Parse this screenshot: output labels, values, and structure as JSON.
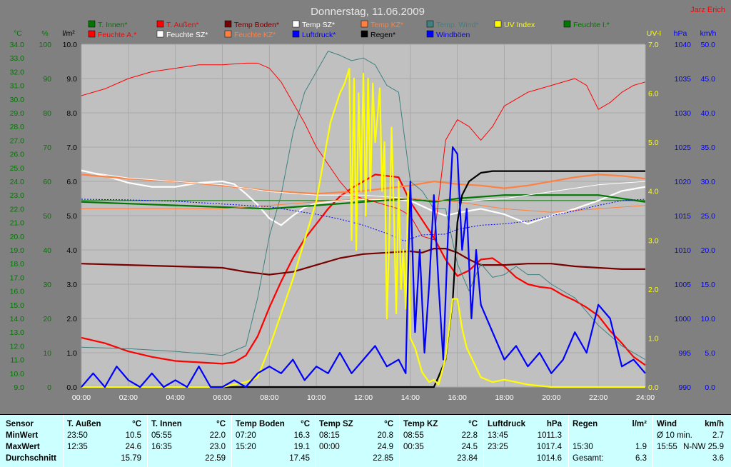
{
  "title": "Donnerstag, 11.06.2009",
  "author": "Jarz Erich",
  "colors": {
    "background": "#808080",
    "plot_background": "#c0c0c0",
    "stats_background": "#ccffff"
  },
  "legend": [
    {
      "label": "T. Innen*",
      "color": "#007700"
    },
    {
      "label": "T. Außen*",
      "color": "#ff0000"
    },
    {
      "label": "Temp Boden*",
      "color": "#770000"
    },
    {
      "label": "Temp SZ*",
      "color": "#ffffff"
    },
    {
      "label": "Temp KZ*",
      "color": "#ff8040"
    },
    {
      "label": "Temp. Wind*",
      "color": "#408080"
    },
    {
      "label": "UV Index",
      "color": "#ffff00"
    },
    {
      "label": "Feuchte I.*",
      "color": "#007700"
    },
    {
      "label": "Feuchte A.*",
      "color": "#ff0000"
    },
    {
      "label": "Feuchte SZ*",
      "color": "#ffffff"
    },
    {
      "label": "Feuchte KZ*",
      "color": "#ff8040"
    },
    {
      "label": "Luftdruck*",
      "color": "#0000ff"
    },
    {
      "label": "Regen*",
      "color": "#000000"
    },
    {
      "label": "Windböen",
      "color": "#0000ff"
    }
  ],
  "axes": {
    "temp": {
      "unit": "°C",
      "color": "#007700",
      "ticks": [
        "9.0",
        "10.0",
        "11.0",
        "12.0",
        "13.0",
        "14.0",
        "15.0",
        "16.0",
        "17.0",
        "18.0",
        "19.0",
        "20.0",
        "21.0",
        "22.0",
        "23.0",
        "24.0",
        "25.0",
        "26.0",
        "27.0",
        "28.0",
        "29.0",
        "30.0",
        "31.0",
        "32.0",
        "33.0",
        "34.0"
      ]
    },
    "humidity": {
      "unit": "%",
      "color": "#007700",
      "ticks": [
        "0",
        "10",
        "20",
        "30",
        "40",
        "50",
        "60",
        "70",
        "80",
        "90",
        "100"
      ]
    },
    "rain": {
      "unit": "l/m²",
      "color": "#000000",
      "ticks": [
        "0.0",
        "1.0",
        "2.0",
        "3.0",
        "4.0",
        "5.0",
        "6.0",
        "7.0",
        "8.0",
        "9.0",
        "10.0"
      ]
    },
    "uv": {
      "unit": "UV-I",
      "color": "#ffff00",
      "ticks": [
        "0.0",
        "1.0",
        "2.0",
        "3.0",
        "4.0",
        "5.0",
        "6.0",
        "7.0"
      ]
    },
    "pressure": {
      "unit": "hPa",
      "color": "#0000ff",
      "ticks": [
        "990",
        "995",
        "1000",
        "1005",
        "1010",
        "1015",
        "1020",
        "1025",
        "1030",
        "1035",
        "1040"
      ]
    },
    "wind": {
      "unit": "km/h",
      "color": "#0000ff",
      "ticks": [
        "0.0",
        "5.0",
        "10.0",
        "15.0",
        "20.0",
        "25.0",
        "30.0",
        "35.0",
        "40.0",
        "45.0",
        "50.0"
      ]
    },
    "time": {
      "ticks": [
        "00:00",
        "02:00",
        "04:00",
        "06:00",
        "08:00",
        "10:00",
        "12:00",
        "14:00",
        "16:00",
        "18:00",
        "20:00",
        "22:00",
        "24:00"
      ]
    }
  },
  "chart_data": {
    "type": "line",
    "title": "Donnerstag, 11.06.2009",
    "x_unit": "hour of day",
    "xlim": [
      0,
      24
    ],
    "grid": true,
    "series": [
      {
        "name": "T. Innen*",
        "axis": "temp",
        "color": "#007700",
        "x": [
          0,
          24
        ],
        "y": [
          22.6,
          22.6
        ]
      },
      {
        "name": "T. Außen*",
        "axis": "temp",
        "color": "#ff0000",
        "x": [
          0,
          1,
          2,
          3,
          4,
          5,
          6,
          6.5,
          7,
          7.5,
          8,
          8.5,
          9,
          9.5,
          10,
          10.5,
          11,
          11.5,
          12,
          12.5,
          13,
          13.5,
          14,
          14.5,
          15,
          15.5,
          16,
          16.5,
          17,
          17.5,
          18,
          18.5,
          19,
          19.5,
          20,
          20.5,
          21,
          21.5,
          22,
          22.5,
          23,
          23.5,
          24
        ],
        "y": [
          12.6,
          12.2,
          11.6,
          11.2,
          10.9,
          10.8,
          10.7,
          10.8,
          11.3,
          12.7,
          14.8,
          16.7,
          18.4,
          19.8,
          20.9,
          22.0,
          22.9,
          23.5,
          24.0,
          24.5,
          24.4,
          24.3,
          22.5,
          21.2,
          19.9,
          18.3,
          17.1,
          17.5,
          18.3,
          18.4,
          17.8,
          17.0,
          16.5,
          16.3,
          16.2,
          15.7,
          15.3,
          14.8,
          14.2,
          13.1,
          12.2,
          11.2,
          10.6
        ]
      },
      {
        "name": "Temp Boden*",
        "axis": "temp",
        "color": "#770000",
        "x": [
          0,
          2,
          4,
          6,
          7,
          8,
          9,
          10,
          11,
          12,
          13,
          14,
          14.5,
          15,
          15.5,
          16,
          16.5,
          17,
          18,
          19,
          20,
          21,
          22,
          23,
          24
        ],
        "y": [
          18.0,
          17.9,
          17.8,
          17.7,
          17.4,
          17.2,
          17.4,
          17.9,
          18.4,
          18.7,
          18.8,
          18.9,
          18.8,
          19.1,
          19.1,
          18.8,
          18.3,
          17.9,
          17.9,
          18.0,
          18.0,
          17.8,
          17.7,
          17.6,
          17.6
        ]
      },
      {
        "name": "Temp SZ*",
        "axis": "temp",
        "color": "#ffffff",
        "x": [
          0,
          1,
          2,
          3,
          4,
          5,
          6,
          6.5,
          7,
          7.5,
          8,
          8.5,
          9,
          9.5,
          10,
          11,
          12,
          13,
          14,
          15,
          15.5,
          16,
          17,
          18,
          19,
          20,
          21,
          22,
          23,
          24
        ],
        "y": [
          24.8,
          24.4,
          23.9,
          23.6,
          23.6,
          23.9,
          24.0,
          23.8,
          23.1,
          22.3,
          21.3,
          20.8,
          21.5,
          22.1,
          22.4,
          22.6,
          22.7,
          22.7,
          22.6,
          21.8,
          21.5,
          21.7,
          22.0,
          21.6,
          20.9,
          21.5,
          22.0,
          22.6,
          23.3,
          23.6
        ]
      },
      {
        "name": "Temp KZ*",
        "axis": "temp",
        "color": "#ff8040",
        "x": [
          0,
          2,
          4,
          6,
          8,
          10,
          12,
          14,
          15,
          16,
          17,
          18,
          19,
          20,
          21,
          22,
          23,
          24
        ],
        "y": [
          24.5,
          24.2,
          24.0,
          23.7,
          23.3,
          23.1,
          23.3,
          23.7,
          24.0,
          23.8,
          23.7,
          23.5,
          23.7,
          24.0,
          24.3,
          24.5,
          24.4,
          24.2
        ]
      },
      {
        "name": "Temp. Wind*",
        "axis": "temp",
        "color": "#408080",
        "x": [
          0,
          2,
          4,
          6,
          7,
          7.5,
          8,
          8.5,
          9,
          9.5,
          10,
          10.5,
          11,
          11.5,
          12,
          12.5,
          13,
          13.5,
          14,
          14.5,
          15,
          15.5,
          16,
          16.5,
          17,
          17.5,
          18,
          18.5,
          19,
          19.5,
          20,
          21,
          22,
          23,
          24
        ],
        "y": [
          11.9,
          11.8,
          11.6,
          11.3,
          12.0,
          15.5,
          20.0,
          23.0,
          27.5,
          30.5,
          32.0,
          33.5,
          33.2,
          32.8,
          33.0,
          32.5,
          31.0,
          30.5,
          24.0,
          23.3,
          22.0,
          22.0,
          18.0,
          16.0,
          18.0,
          17.0,
          17.2,
          17.8,
          17.2,
          17.2,
          16.5,
          15.5,
          13.5,
          12.0,
          11.0
        ]
      },
      {
        "name": "Feuchte I.*",
        "axis": "humidity",
        "color": "#007700",
        "x": [
          0,
          2,
          4,
          6,
          8,
          10,
          12,
          14,
          15,
          16,
          18,
          20,
          22,
          24
        ],
        "y": [
          54,
          53.5,
          53,
          52.5,
          52,
          53,
          54,
          55,
          54,
          55,
          56,
          56,
          56,
          54
        ]
      },
      {
        "name": "Feuchte A.*",
        "axis": "humidity",
        "color": "#ff0000",
        "x": [
          0,
          1,
          2,
          3,
          4,
          5,
          6,
          7,
          7.5,
          8,
          8.5,
          9,
          9.5,
          10,
          10.5,
          11,
          11.5,
          12,
          12.5,
          13,
          13.5,
          14,
          14.5,
          15,
          15.5,
          16,
          16.5,
          17,
          17.5,
          18,
          19,
          20,
          21,
          21.5,
          22,
          22.5,
          23,
          23.5,
          24
        ],
        "y": [
          85,
          87,
          90,
          92,
          93,
          94,
          94,
          94.5,
          94.5,
          93,
          89,
          83,
          77,
          70,
          65,
          60,
          56,
          55,
          54,
          53,
          52,
          50,
          44,
          43,
          72,
          78,
          76,
          72,
          76,
          82,
          86,
          88,
          90,
          88,
          81,
          83,
          86,
          88,
          89
        ]
      },
      {
        "name": "Feuchte SZ*",
        "axis": "humidity",
        "color": "#ffffff",
        "x": [
          0,
          2,
          4,
          6,
          8,
          10,
          12,
          14,
          16,
          18,
          20,
          22,
          24
        ],
        "y": [
          63,
          61,
          60,
          59,
          57,
          56,
          56,
          55,
          54,
          55,
          57,
          59,
          60
        ]
      },
      {
        "name": "Feuchte KZ*",
        "axis": "humidity",
        "color": "#ff8040",
        "x": [
          0,
          2,
          4,
          6,
          8,
          10,
          12,
          14,
          16,
          18,
          20,
          22,
          24
        ],
        "y": [
          52,
          52,
          52,
          52,
          53,
          54,
          55,
          55,
          54,
          52,
          51,
          52,
          53
        ]
      },
      {
        "name": "Luftdruck*",
        "axis": "pressure",
        "color": "#0000ff",
        "x": [
          0,
          2,
          4,
          6,
          8,
          10,
          11,
          12,
          13,
          13.75,
          14.5,
          15.5,
          16,
          17,
          18,
          19,
          20,
          21,
          22,
          23,
          24
        ],
        "y": [
          1017.4,
          1017.3,
          1017.1,
          1016.7,
          1016.3,
          1015.2,
          1014.5,
          1013.6,
          1012.4,
          1011.3,
          1012.2,
          1012.3,
          1013.0,
          1013.6,
          1013.8,
          1014.2,
          1015.0,
          1015.7,
          1016.5,
          1017.2,
          1017.4
        ]
      },
      {
        "name": "Regen*",
        "axis": "rain",
        "color": "#000000",
        "x": [
          0,
          15.0,
          15.2,
          15.5,
          15.8,
          16.0,
          16.2,
          16.5,
          17.0,
          17.5,
          18,
          24
        ],
        "y": [
          0,
          0,
          0.3,
          0.8,
          2.5,
          4.8,
          5.6,
          6.0,
          6.25,
          6.3,
          6.3,
          6.3
        ]
      },
      {
        "name": "UV Index",
        "axis": "uv",
        "color": "#ffff00",
        "x": [
          0,
          6,
          6.5,
          7,
          7.5,
          8,
          8.5,
          9,
          9.5,
          10,
          10.3,
          10.6,
          11,
          11.2,
          11.4,
          11.5,
          11.6,
          11.7,
          11.8,
          11.9,
          12,
          12.1,
          12.2,
          12.3,
          12.4,
          12.5,
          12.6,
          12.7,
          12.8,
          12.9,
          13,
          13.1,
          13.2,
          13.3,
          13.4,
          13.5,
          13.6,
          13.7,
          13.8,
          13.9,
          14,
          14.2,
          14.5,
          14.8,
          15,
          15.2,
          15.5,
          15.8,
          16,
          16.2,
          16.4,
          16.6,
          16.8,
          17,
          17.5,
          18,
          19,
          20,
          21,
          22,
          23,
          24
        ],
        "y": [
          0,
          0,
          0.05,
          0.1,
          0.2,
          0.8,
          1.5,
          2.2,
          3.0,
          3.8,
          4.6,
          5.4,
          6.0,
          6.2,
          6.5,
          3.0,
          6.3,
          2.8,
          6.0,
          4.0,
          6.4,
          3.5,
          6.3,
          4.0,
          6.2,
          5.0,
          5.5,
          6.1,
          4.0,
          5.0,
          1.4,
          3.0,
          5.3,
          3.5,
          1.5,
          4.2,
          2.0,
          2.8,
          1.6,
          4.0,
          1.0,
          0.8,
          0.3,
          0.1,
          0.15,
          0.05,
          0.6,
          1.8,
          1.8,
          1.2,
          0.8,
          0.6,
          0.4,
          0.2,
          0.1,
          0.15,
          0.05,
          0,
          0,
          0,
          0,
          0
        ]
      },
      {
        "name": "Windböen",
        "axis": "wind",
        "color": "#0000ff",
        "x": [
          0,
          0.5,
          1,
          1.5,
          2,
          2.5,
          3,
          3.5,
          4,
          4.5,
          5,
          5.5,
          6,
          6.5,
          7,
          7.5,
          8,
          8.5,
          9,
          9.5,
          10,
          10.5,
          11,
          11.5,
          12,
          12.5,
          13,
          13.5,
          13.8,
          14,
          14.2,
          14.4,
          14.6,
          14.8,
          15,
          15.2,
          15.4,
          15.6,
          15.8,
          16,
          16.2,
          16.4,
          16.6,
          16.8,
          17,
          17.5,
          18,
          18.5,
          19,
          19.5,
          20,
          20.5,
          21,
          21.5,
          22,
          22.5,
          23,
          23.5,
          24
        ],
        "y": [
          0,
          2,
          0,
          3,
          1,
          0,
          2,
          0,
          1,
          0,
          3,
          0,
          0,
          1,
          0,
          2,
          3,
          2,
          4,
          1,
          3,
          2,
          5,
          2,
          4,
          6,
          3,
          4,
          2,
          30,
          8,
          20,
          5,
          15,
          28,
          15,
          4,
          22,
          35,
          34,
          20,
          26,
          10,
          20,
          12,
          8,
          4,
          6,
          3,
          5,
          2,
          4,
          8,
          5,
          12,
          10,
          3,
          4,
          2
        ]
      }
    ]
  },
  "stats": {
    "row_labels": [
      "Sensor",
      "MinWert",
      "MaxWert",
      "Durchschnitt"
    ],
    "columns": [
      {
        "name": "T. Außen",
        "unit": "°C",
        "min_time": "23:50",
        "min": "10.5",
        "max_time": "12:35",
        "max": "24.6",
        "avg": "15.79"
      },
      {
        "name": "T. Innen",
        "unit": "°C",
        "min_time": "05:55",
        "min": "22.0",
        "max_time": "16:35",
        "max": "23.0",
        "avg": "22.59"
      },
      {
        "name": "Temp Boden",
        "unit": "°C",
        "min_time": "07:20",
        "min": "16.3",
        "max_time": "15:20",
        "max": "19.1",
        "avg": "17.45"
      },
      {
        "name": "Temp SZ",
        "unit": "°C",
        "min_time": "08:15",
        "min": "20.8",
        "max_time": "00:00",
        "max": "24.9",
        "avg": "22.85"
      },
      {
        "name": "Temp KZ",
        "unit": "°C",
        "min_time": "08:55",
        "min": "22.8",
        "max_time": "00:35",
        "max": "24.5",
        "avg": "23.84"
      },
      {
        "name": "Luftdruck",
        "unit": "hPa",
        "min_time": "13:45",
        "min": "1011.3",
        "max_time": "23:25",
        "max": "1017.4",
        "avg": "1014.6"
      },
      {
        "name": "Regen",
        "unit": "l/m²",
        "min_time": "",
        "min": "",
        "max_time": "15:30",
        "max": "1.9",
        "avg_label": "Gesamt:",
        "avg": "6.3"
      },
      {
        "name": "Wind",
        "unit": "km/h",
        "min_time": "Ø 10 min.",
        "min": "2.7",
        "max_time": "15:55",
        "max": "N-NW 25.9",
        "avg": "3.6"
      }
    ]
  }
}
